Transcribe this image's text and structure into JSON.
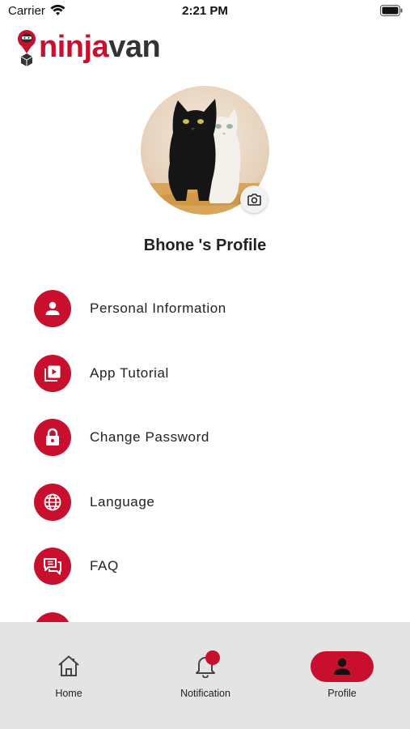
{
  "status_bar": {
    "carrier": "Carrier",
    "time": "2:21 PM"
  },
  "logo": {
    "part1": "ninja",
    "part2": "van"
  },
  "profile": {
    "title": "Bhone 's Profile"
  },
  "menu": {
    "items": [
      {
        "label": "Personal Information",
        "icon": "person-icon"
      },
      {
        "label": "App Tutorial",
        "icon": "video-library-icon"
      },
      {
        "label": "Change Password",
        "icon": "lock-icon"
      },
      {
        "label": "Language",
        "icon": "globe-icon"
      },
      {
        "label": "FAQ",
        "icon": "chat-bubbles-icon"
      }
    ]
  },
  "bottom_nav": {
    "home": "Home",
    "notification": "Notification",
    "profile": "Profile"
  },
  "colors": {
    "brand": "#c8102e",
    "nav_bg": "#e4e4e4",
    "text": "#222222"
  }
}
